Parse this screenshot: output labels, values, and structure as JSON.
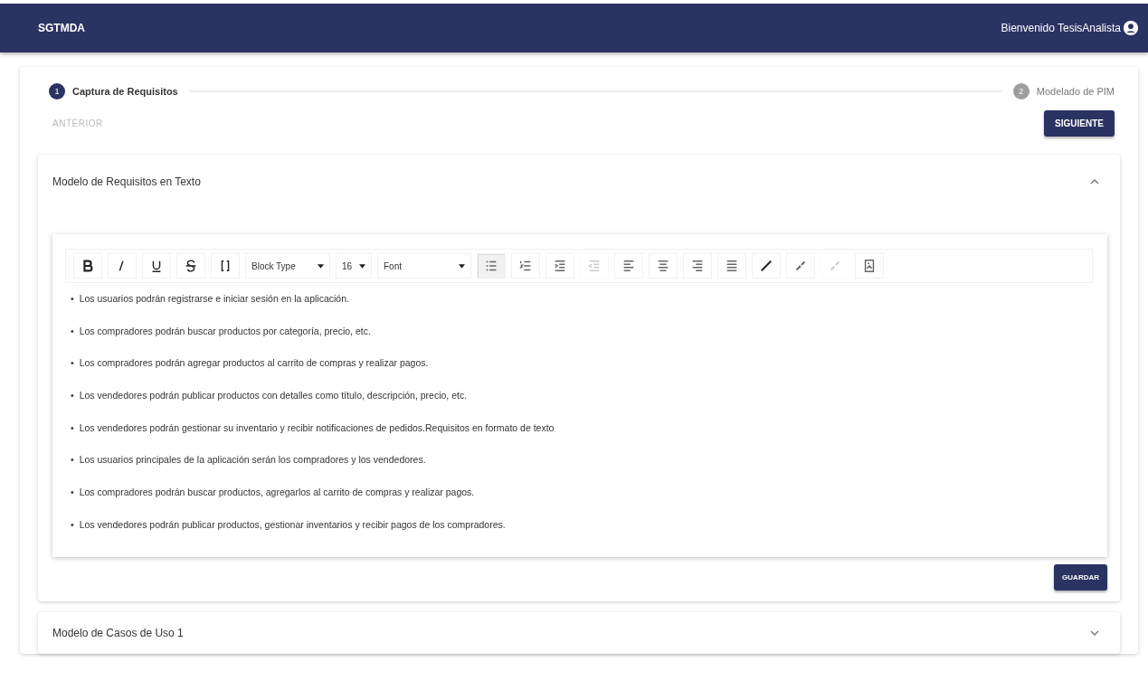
{
  "app_bar": {
    "title": "SGTMDA",
    "greeting": "Bienvenido TesisAnalista"
  },
  "steps": [
    {
      "number": "1",
      "label": "Captura de Requisitos",
      "selected": true
    },
    {
      "number": "2",
      "label": "Modelado de PIM",
      "selected": false
    }
  ],
  "nav": {
    "back": {
      "label": "ANTERIOR",
      "disabled": true
    },
    "next": {
      "label": "SIGUIENTE",
      "disabled": false
    }
  },
  "panels": [
    {
      "title": "Modelo de Requisitos en Texto",
      "expanded": true,
      "editor": {
        "format_buttons": [
          {
            "active": false
          },
          {
            "active": false
          },
          {
            "active": false
          },
          {
            "active": false
          },
          {
            "active": false
          }
        ],
        "selects": [
          {
            "value": "Block Type"
          },
          {
            "value": "16"
          },
          {
            "value": "Font"
          }
        ],
        "block_buttons": [
          {
            "active": true,
            "disabled": false
          },
          {
            "active": false,
            "disabled": false
          },
          {
            "active": false,
            "disabled": false
          },
          {
            "active": false,
            "disabled": true
          },
          {
            "active": false,
            "disabled": false
          },
          {
            "active": false,
            "disabled": false
          },
          {
            "active": false,
            "disabled": false
          },
          {
            "active": false,
            "disabled": false
          },
          {
            "active": false,
            "disabled": false
          },
          {
            "active": false,
            "disabled": false
          },
          {
            "active": false,
            "disabled": true
          },
          {
            "active": false,
            "disabled": false
          }
        ],
        "items": [
          {
            "marker": "•",
            "text": "Los usuarios podrán registrarse e iniciar sesión en la aplicación."
          },
          {
            "marker": "•",
            "text": "Los compradores podrán buscar productos por categoría, precio, etc."
          },
          {
            "marker": "•",
            "text": "Los compradores podrán agregar productos al carrito de compras y realizar pagos."
          },
          {
            "marker": "•",
            "text": "Los vendedores podrán publicar productos con detalles como título, descripción, precio, etc."
          },
          {
            "marker": "•",
            "text": "Los vendedores podrán gestionar su inventario y recibir notificaciones de pedidos.Requisitos en formato de texto"
          },
          {
            "marker": "•",
            "text": "Los usuarios principales de la aplicación serán los compradores y los vendedores."
          },
          {
            "marker": "•",
            "text": "Los compradores podrán buscar productos, agregarlos al carrito de compras y realizar pagos."
          },
          {
            "marker": "•",
            "text": "Los vendedores podrán publicar productos, gestionar inventarios y recibir pagos de los compradores."
          }
        ]
      },
      "save_label": "GUARDAR"
    },
    {
      "title": "Modelo de Casos de Uso 1",
      "expanded": false
    }
  ]
}
